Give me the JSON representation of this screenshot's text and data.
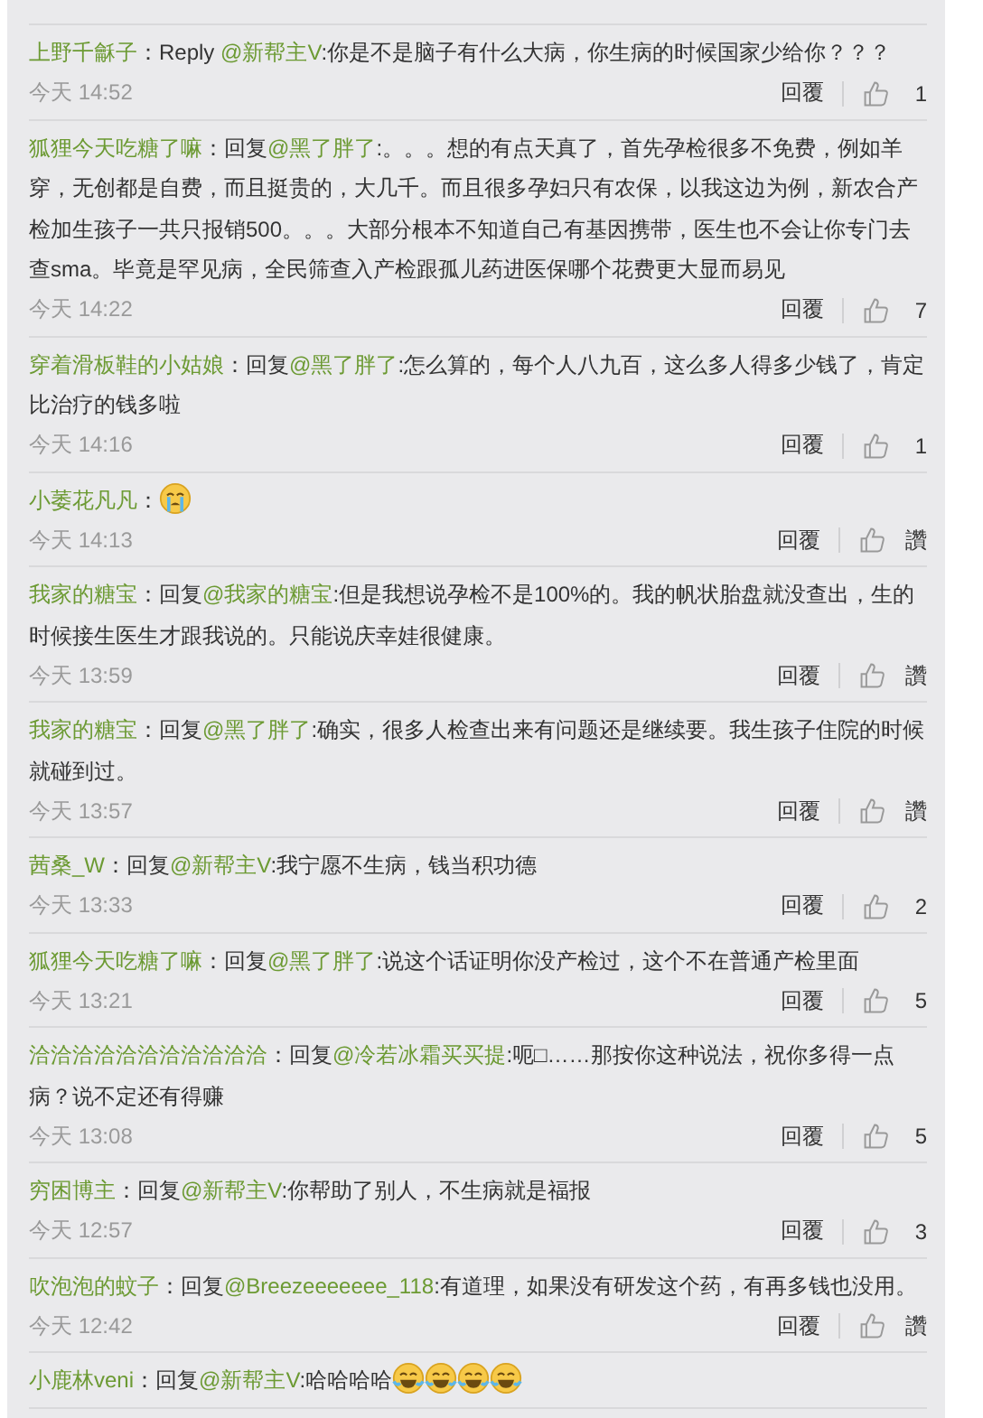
{
  "comments": [
    {
      "user": "上野千龢子",
      "prefix": "：Reply ",
      "mention": "@新帮主V",
      "text": ":你是不是脑子有什么大病，你生病的时候国家少给你？？？",
      "time": "今天 14:52",
      "reply_label": "回覆",
      "likes": "1"
    },
    {
      "user": "狐狸今天吃糖了嘛",
      "prefix": "：回复",
      "mention": "@黑了胖了",
      "text": ":。。。想的有点天真了，首先孕检很多不免费，例如羊穿，无创都是自费，而且挺贵的，大几千。而且很多孕妇只有农保，以我这边为例，新农合产检加生孩子一共只报销500。。。大部分根本不知道自己有基因携带，医生也不会让你专门去查sma。毕竟是罕见病，全民筛查入产检跟孤儿药进医保哪个花费更大显而易见",
      "time": "今天 14:22",
      "reply_label": "回覆",
      "likes": "7"
    },
    {
      "user": "穿着滑板鞋的小姑娘",
      "prefix": "：回复",
      "mention": "@黑了胖了",
      "text": ":怎么算的，每个人八九百，这么多人得多少钱了，肯定比治疗的钱多啦",
      "time": "今天 14:16",
      "reply_label": "回覆",
      "likes": "1"
    },
    {
      "user": "小萎花凡凡",
      "prefix": "：",
      "emojis": [
        {
          "kind": "crying"
        }
      ],
      "time": "今天 14:13",
      "reply_label": "回覆",
      "likes": "讚"
    },
    {
      "user": "我家的糖宝",
      "prefix": "：回复",
      "mention": "@我家的糖宝",
      "text": ":但是我想说孕检不是100%的。我的帆状胎盘就没查出，生的时候接生医生才跟我说的。只能说庆幸娃很健康。",
      "time": "今天 13:59",
      "reply_label": "回覆",
      "likes": "讚"
    },
    {
      "user": "我家的糖宝",
      "prefix": "：回复",
      "mention": "@黑了胖了",
      "text": ":确实，很多人检查出来有问题还是继续要。我生孩子住院的时候就碰到过。",
      "time": "今天 13:57",
      "reply_label": "回覆",
      "likes": "讚"
    },
    {
      "user": "茜桑_W",
      "prefix": "：回复",
      "mention": "@新帮主V",
      "text": ":我宁愿不生病，钱当积功德",
      "time": "今天 13:33",
      "reply_label": "回覆",
      "likes": "2"
    },
    {
      "user": "狐狸今天吃糖了嘛",
      "prefix": "：回复",
      "mention": "@黑了胖了",
      "text": ":说这个话证明你没产检过，这个不在普通产检里面",
      "time": "今天 13:21",
      "reply_label": "回覆",
      "likes": "5"
    },
    {
      "user": "洽洽洽洽洽洽洽洽洽洽洽",
      "prefix": "：回复",
      "mention": "@冷若冰霜买买提",
      "text": ":呃□……那按你这种说法，祝你多得一点病？说不定还有得赚",
      "time": "今天 13:08",
      "reply_label": "回覆",
      "likes": "5"
    },
    {
      "user": "穷困博主",
      "prefix": "：回复",
      "mention": "@新帮主V",
      "text": ":你帮助了别人，不生病就是福报",
      "time": "今天 12:57",
      "reply_label": "回覆",
      "likes": "3"
    },
    {
      "user": "吹泡泡的蚊子",
      "prefix": "：回复",
      "mention": "@Breezeeeeeee_118",
      "text": ":有道理，如果没有研发这个药，有再多钱也没用。",
      "time": "今天 12:42",
      "reply_label": "回覆",
      "likes": "讚"
    },
    {
      "user": "小鹿林veni",
      "prefix": "：回复",
      "mention": "@新帮主V",
      "text": ":哈哈哈哈",
      "emojis": [
        {
          "kind": "laughing"
        },
        {
          "kind": "laughing"
        },
        {
          "kind": "laughing"
        },
        {
          "kind": "laughing"
        }
      ]
    }
  ]
}
